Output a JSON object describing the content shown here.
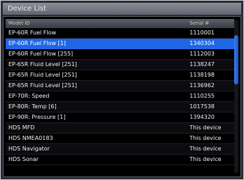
{
  "window": {
    "title": "Device List"
  },
  "table": {
    "headers": {
      "model": "Model ID",
      "serial": "Serial #"
    },
    "selected_index": 1,
    "rows": [
      {
        "model": "EP-60R Fuel Flow",
        "serial": "1110001"
      },
      {
        "model": "EP-60R Fuel Flow [1]",
        "serial": "1340304"
      },
      {
        "model": "EP-60R Fuel Flow [255]",
        "serial": "1112003"
      },
      {
        "model": "EP-65R Fluid Level [251]",
        "serial": "1138247"
      },
      {
        "model": "EP-65R Fluid Level [251]",
        "serial": "1138198"
      },
      {
        "model": "EP-65R Fluid Level [251]",
        "serial": "1136962"
      },
      {
        "model": "EP-70R: Speed",
        "serial": "1110255"
      },
      {
        "model": "EP-80R: Temp [6]",
        "serial": "1017538"
      },
      {
        "model": "EP-90R: Pressure [1]",
        "serial": "1394320"
      },
      {
        "model": "HDS MFD",
        "serial": "This device"
      },
      {
        "model": "HDS NMEA0183",
        "serial": "This device"
      },
      {
        "model": "HDS Navigator",
        "serial": "This device"
      },
      {
        "model": "HDS Sonar",
        "serial": "This device"
      }
    ]
  },
  "scrollbar": {
    "position_fraction": 0.1,
    "visible_fraction": 0.32
  }
}
